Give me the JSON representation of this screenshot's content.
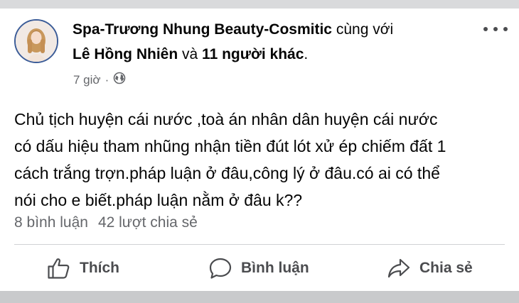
{
  "post": {
    "author": "Spa-Trương Nhung Beauty-Cosmitic",
    "with_word": "cùng với",
    "tagged_person": "Lê Hồng Nhiên",
    "and_word": "và",
    "others": "11 người khác",
    "period": ".",
    "time": "7 giờ",
    "separator": "·",
    "privacy_icon": "globe-icon",
    "body_lines": [
      "Chủ tịch huyện cái nước ,toà án nhân dân huyện cái nước",
      "có dấu hiệu tham nhũng nhận tiền đút lót xử ép chiếm đất 1",
      "cách trắng trợn.pháp luận ở đâu,công lý ở đâu.có ai có thể",
      "nói cho e biết.pháp luận nằm ở đâu k??"
    ]
  },
  "stats": {
    "comments": "8 bình luận",
    "shares": "42 lượt chia sẻ"
  },
  "actions": {
    "like_label": "Thích",
    "comment_label": "Bình luận",
    "share_label": "Chia sẻ"
  },
  "colors": {
    "text": "#050505",
    "secondary": "#65676b",
    "action": "#4b4c4f",
    "avatar_ring": "#3b5c98"
  }
}
